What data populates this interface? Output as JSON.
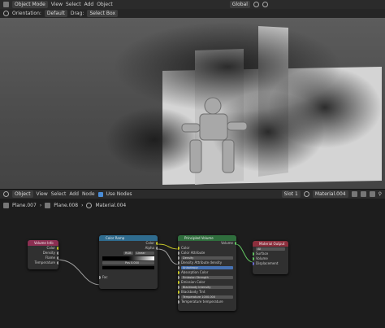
{
  "viewport_header": {
    "mode": "Object Mode",
    "menus": [
      "View",
      "Select",
      "Add",
      "Object"
    ],
    "transform": "Global"
  },
  "viewport_sub": {
    "orientation_label": "Orientation:",
    "orientation_value": "Default",
    "drag_label": "Drag:",
    "drag_value": "Select Box"
  },
  "node_header": {
    "editor": "Object",
    "menus": [
      "View",
      "Select",
      "Add",
      "Node"
    ],
    "use_nodes": "Use Nodes",
    "slot": "Slot 1",
    "material": "Material.004"
  },
  "breadcrumb": [
    "Plane.007",
    "Plane.008",
    "Material.004"
  ],
  "nodes": {
    "volume_info": {
      "title": "Volume Info",
      "outputs": [
        "Color",
        "Density",
        "Flame",
        "Temperature"
      ]
    },
    "color_ramp": {
      "title": "Color Ramp",
      "outputs": [
        "Color",
        "Alpha"
      ],
      "mode": "RGB",
      "interp": "Linear",
      "pos_label": "Pos",
      "pos_value": "0.000",
      "input": "Fac"
    },
    "principled": {
      "title": "Principled Volume",
      "output": "Volume",
      "rows": [
        "Color",
        "Color Attribute",
        "Density",
        "Density Attribute",
        "Anisotropy",
        "Absorption Color",
        "Emission Strength",
        "Emission Color",
        "Blackbody Intensity",
        "Blackbody Tint",
        "Temperature",
        "Temperature"
      ],
      "density_attr": "density",
      "temp_value": "1000.000",
      "temp_attr": "temperature"
    },
    "material_output": {
      "title": "Material Output",
      "target": "All",
      "inputs": [
        "Surface",
        "Volume",
        "Displacement"
      ]
    }
  },
  "colors": {
    "volume_info": "#8c2f52",
    "color_ramp": "#2f6c8f",
    "principled": "#2f6e3d",
    "material_output": "#8c2f3d",
    "link": "#c7c729"
  }
}
